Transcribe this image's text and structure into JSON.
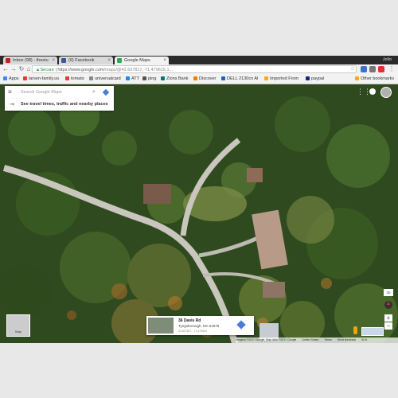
{
  "browser": {
    "tabs": [
      {
        "label": "Inbox (98) - thestu",
        "active": false,
        "icon": "gmail-icon",
        "icon_color": "#c5221f"
      },
      {
        "label": "(6) Facebook",
        "active": false,
        "icon": "facebook-icon",
        "icon_color": "#3b5998"
      },
      {
        "label": "Google Maps",
        "active": true,
        "icon": "maps-icon",
        "icon_color": "#34a853"
      }
    ],
    "user": "Jello",
    "secure_label": "Secure",
    "url_host": "https://www.google.com",
    "url_path": "/maps/@42.627817,-71.479615,1...",
    "bookmarks": [
      {
        "label": "Apps",
        "color": "#4285f4"
      },
      {
        "label": "larsen-family.us",
        "color": "#e53935"
      },
      {
        "label": "tomato",
        "color": "#e53935"
      },
      {
        "label": "universalcard",
        "color": "#888888"
      },
      {
        "label": "ATT",
        "color": "#1e88e5"
      },
      {
        "label": "ping",
        "color": "#555555"
      },
      {
        "label": "Zions Bank",
        "color": "#00796b"
      },
      {
        "label": "Discover",
        "color": "#f57c00"
      },
      {
        "label": "DELL 2130cn Al",
        "color": "#1565c0"
      },
      {
        "label": "Imported From",
        "color": "#f9a825"
      },
      {
        "label": "paypal",
        "color": "#1a237e"
      },
      {
        "label": "Other bookmarks",
        "color": "#f9a825"
      }
    ]
  },
  "map": {
    "search_placeholder": "Search Google Maps",
    "travel_text": "See travel times, traffic and nearby places",
    "road_label": "Davis Rd",
    "infocard": {
      "address_line1": "36 Davis Rd",
      "address_line2": "Tyngsborough, MA 01879",
      "coords": "42.627817, -71.479634"
    },
    "earth_label": "Map",
    "zoom_in": "+",
    "zoom_out": "−",
    "tilt_label": "3D",
    "status": [
      "Imagery ©2017 Google, Map data ©2017 Google",
      "United States",
      "Terms",
      "Send feedback",
      "50 ft"
    ]
  },
  "colors": {
    "forest": "#2f4a1f",
    "road": "#c9c6bd",
    "accent": "#4a7bd8"
  }
}
